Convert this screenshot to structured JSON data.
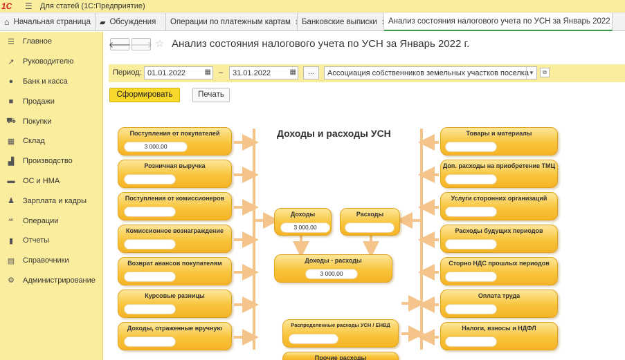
{
  "window": {
    "logo": "1С",
    "title": "Для статей  (1С:Предприятие)"
  },
  "tabs": [
    {
      "label": "Начальная страница"
    },
    {
      "label": "Обсуждения"
    },
    {
      "label": "Операции по платежным картам"
    },
    {
      "label": "Банковские выписки"
    },
    {
      "label": "Анализ состояния налогового учета по УСН за Январь 2022 г."
    }
  ],
  "sidebar": {
    "items": [
      {
        "label": "Главное",
        "icon": "menu-icon"
      },
      {
        "label": "Руководителю",
        "icon": "trend-icon"
      },
      {
        "label": "Банк и касса",
        "icon": "coin-icon"
      },
      {
        "label": "Продажи",
        "icon": "bag-icon"
      },
      {
        "label": "Покупки",
        "icon": "cart-icon"
      },
      {
        "label": "Склад",
        "icon": "grid-icon"
      },
      {
        "label": "Производство",
        "icon": "factory-icon"
      },
      {
        "label": "ОС и НМА",
        "icon": "truck-icon"
      },
      {
        "label": "Зарплата и кадры",
        "icon": "person-icon"
      },
      {
        "label": "Операции",
        "icon": "dt-kt-icon"
      },
      {
        "label": "Отчеты",
        "icon": "bar-chart-icon"
      },
      {
        "label": "Справочники",
        "icon": "book-icon"
      },
      {
        "label": "Администрирование",
        "icon": "gear-icon"
      }
    ]
  },
  "page": {
    "title": "Анализ состояния налогового учета по УСН за Январь 2022 г."
  },
  "filter": {
    "period_label": "Период:",
    "date_from": "01.01.2022",
    "date_to": "31.01.2022",
    "dash": "–",
    "dots": "...",
    "organization": "Ассоциация собственников земельных участков поселка"
  },
  "toolbar": {
    "generate_label": "Сформировать",
    "print_label": "Печать"
  },
  "diagram": {
    "title": "Доходы и расходы УСН",
    "income_boxes": [
      {
        "title": "Поступления от покупателей",
        "value": "3 000,00"
      },
      {
        "title": "Розничная выручка",
        "value": ""
      },
      {
        "title": "Поступления от комиссионеров",
        "value": ""
      },
      {
        "title": "Комиссионное вознаграждение",
        "value": ""
      },
      {
        "title": "Возврат авансов покупателям",
        "value": ""
      },
      {
        "title": "Курсовые разницы",
        "value": ""
      },
      {
        "title": "Доходы, отраженные вручную",
        "value": ""
      }
    ],
    "expense_boxes": [
      {
        "title": "Товары и материалы",
        "value": ""
      },
      {
        "title": "Доп. расходы на приобретение ТМЦ",
        "value": ""
      },
      {
        "title": "Услуги сторонних организаций",
        "value": ""
      },
      {
        "title": "Расходы будущих периодов",
        "value": ""
      },
      {
        "title": "Сторно НДС прошлых периодов",
        "value": ""
      },
      {
        "title": "Оплата труда",
        "value": ""
      },
      {
        "title": "Налоги, взносы и НДФЛ",
        "value": ""
      }
    ],
    "center": {
      "income": {
        "title": "Доходы",
        "value": "3 000,00"
      },
      "expense": {
        "title": "Расходы",
        "value": ""
      },
      "result": {
        "title": "Доходы - расходы",
        "value": "3 000,00"
      },
      "distributed": {
        "title": "Распределенные расходы УСН / ЕНВД",
        "value": ""
      },
      "other": {
        "title": "Прочие расходы",
        "value": ""
      }
    }
  },
  "colors": {
    "accent_yellow": "#fbed9e",
    "box_orange": "#f8c43c",
    "arrow": "#f5c48a",
    "active_tab_underline": "#3a9a49"
  }
}
